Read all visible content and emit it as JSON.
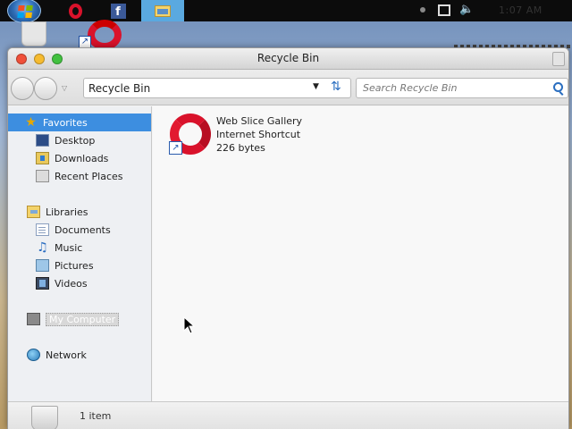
{
  "taskbar": {
    "start_icon": "windows-orb-icon",
    "pinned": [
      {
        "name": "opera",
        "icon": "opera-icon"
      },
      {
        "name": "facebook",
        "icon": "facebook-icon",
        "glyph": "f"
      },
      {
        "name": "windows-explorer",
        "icon": "folder-icon",
        "active": true
      }
    ],
    "tray": {
      "icons": [
        "notification-dot-icon",
        "network-icon",
        "volume-icon"
      ],
      "clock": "1:07 AM"
    }
  },
  "window": {
    "title": "Recycle Bin",
    "address": "Recycle Bin",
    "search_placeholder": "Search Recycle Bin"
  },
  "sidebar": {
    "favorites": {
      "label": "Favorites",
      "items": [
        {
          "label": "Desktop",
          "icon": "desktop-icon"
        },
        {
          "label": "Downloads",
          "icon": "downloads-folder-icon"
        },
        {
          "label": "Recent Places",
          "icon": "recent-places-icon"
        }
      ]
    },
    "libraries": {
      "label": "Libraries",
      "items": [
        {
          "label": "Documents",
          "icon": "documents-icon"
        },
        {
          "label": "Music",
          "icon": "music-icon"
        },
        {
          "label": "Pictures",
          "icon": "pictures-icon"
        },
        {
          "label": "Videos",
          "icon": "videos-icon"
        }
      ]
    },
    "computer": {
      "label": "My Computer",
      "icon": "computer-icon"
    },
    "network": {
      "label": "Network",
      "icon": "network-icon"
    }
  },
  "files": [
    {
      "name": "Web Slice Gallery",
      "type": "Internet Shortcut",
      "size": "226 bytes",
      "icon": "opera-icon"
    }
  ],
  "status": {
    "count": "1 item",
    "icon": "recycle-bin-icon"
  },
  "colors": {
    "selection": "#3d8ee0",
    "opera_red": "#d9122b",
    "accent_blue": "#2a6ec0"
  }
}
